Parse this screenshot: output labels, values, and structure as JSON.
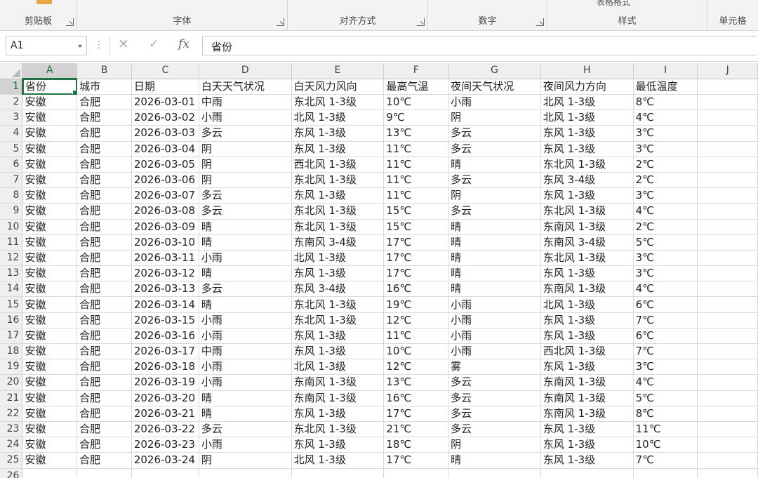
{
  "ribbon": {
    "groups": [
      {
        "label": "剪贴板"
      },
      {
        "label": "字体"
      },
      {
        "label": "对齐方式"
      },
      {
        "label": "数字"
      },
      {
        "label": "样式",
        "partial": "表格格式"
      },
      {
        "label": "单元格"
      }
    ]
  },
  "formula_bar": {
    "name_box": "A1",
    "formula": "省份"
  },
  "sheet": {
    "columns": [
      "A",
      "B",
      "C",
      "D",
      "E",
      "F",
      "G",
      "H",
      "I",
      "J"
    ],
    "rows": [
      [
        "省份",
        "城市",
        "日期",
        "白天天气状况",
        "白天风力风向",
        "最高气温",
        "夜间天气状况",
        "夜间风力方向",
        "最低温度"
      ],
      [
        "安徽",
        "合肥",
        "2026-03-01",
        "中雨",
        "东北风 1-3级",
        "10℃",
        "小雨",
        "北风 1-3级",
        "8℃"
      ],
      [
        "安徽",
        "合肥",
        "2026-03-02",
        "小雨",
        "北风 1-3级",
        "9℃",
        "阴",
        "北风 1-3级",
        "4℃"
      ],
      [
        "安徽",
        "合肥",
        "2026-03-03",
        "多云",
        "东风 1-3级",
        "13℃",
        "多云",
        "东风 1-3级",
        "3℃"
      ],
      [
        "安徽",
        "合肥",
        "2026-03-04",
        "阴",
        "东风 1-3级",
        "11℃",
        "多云",
        "东风 1-3级",
        "3℃"
      ],
      [
        "安徽",
        "合肥",
        "2026-03-05",
        "阴",
        "西北风 1-3级",
        "11℃",
        "晴",
        "东北风 1-3级",
        "2℃"
      ],
      [
        "安徽",
        "合肥",
        "2026-03-06",
        "阴",
        "东北风 1-3级",
        "11℃",
        "多云",
        "东风 3-4级",
        "2℃"
      ],
      [
        "安徽",
        "合肥",
        "2026-03-07",
        "多云",
        "东风 1-3级",
        "11℃",
        "阴",
        "东风 1-3级",
        "3℃"
      ],
      [
        "安徽",
        "合肥",
        "2026-03-08",
        "多云",
        "东北风 1-3级",
        "15℃",
        "多云",
        "东北风 1-3级",
        "4℃"
      ],
      [
        "安徽",
        "合肥",
        "2026-03-09",
        "晴",
        "东北风 1-3级",
        "15℃",
        "晴",
        "东南风 1-3级",
        "2℃"
      ],
      [
        "安徽",
        "合肥",
        "2026-03-10",
        "晴",
        "东南风 3-4级",
        "17℃",
        "晴",
        "东南风 3-4级",
        "5℃"
      ],
      [
        "安徽",
        "合肥",
        "2026-03-11",
        "小雨",
        "北风 1-3级",
        "17℃",
        "晴",
        "东北风 1-3级",
        "3℃"
      ],
      [
        "安徽",
        "合肥",
        "2026-03-12",
        "晴",
        "东风 1-3级",
        "17℃",
        "晴",
        "东风 1-3级",
        "3℃"
      ],
      [
        "安徽",
        "合肥",
        "2026-03-13",
        "多云",
        "东风 3-4级",
        "16℃",
        "晴",
        "东南风 1-3级",
        "4℃"
      ],
      [
        "安徽",
        "合肥",
        "2026-03-14",
        "晴",
        "东北风 1-3级",
        "19℃",
        "小雨",
        "北风 1-3级",
        "6℃"
      ],
      [
        "安徽",
        "合肥",
        "2026-03-15",
        "小雨",
        "东北风 1-3级",
        "12℃",
        "小雨",
        "东风 1-3级",
        "7℃"
      ],
      [
        "安徽",
        "合肥",
        "2026-03-16",
        "小雨",
        "东风 1-3级",
        "11℃",
        "小雨",
        "东风 1-3级",
        "6℃"
      ],
      [
        "安徽",
        "合肥",
        "2026-03-17",
        "中雨",
        "东风 1-3级",
        "10℃",
        "小雨",
        "西北风 1-3级",
        "7℃"
      ],
      [
        "安徽",
        "合肥",
        "2026-03-18",
        "小雨",
        "北风 1-3级",
        "12℃",
        "雾",
        "东风 1-3级",
        "3℃"
      ],
      [
        "安徽",
        "合肥",
        "2026-03-19",
        "小雨",
        "东南风 1-3级",
        "13℃",
        "多云",
        "东南风 1-3级",
        "4℃"
      ],
      [
        "安徽",
        "合肥",
        "2026-03-20",
        "晴",
        "东南风 1-3级",
        "16℃",
        "多云",
        "东南风 1-3级",
        "5℃"
      ],
      [
        "安徽",
        "合肥",
        "2026-03-21",
        "晴",
        "东风 1-3级",
        "17℃",
        "多云",
        "东南风 1-3级",
        "8℃"
      ],
      [
        "安徽",
        "合肥",
        "2026-03-22",
        "多云",
        "东北风 1-3级",
        "21℃",
        "多云",
        "东风 1-3级",
        "11℃"
      ],
      [
        "安徽",
        "合肥",
        "2026-03-23",
        "小雨",
        "东风 1-3级",
        "18℃",
        "阴",
        "东风 1-3级",
        "10℃"
      ],
      [
        "安徽",
        "合肥",
        "2026-03-24",
        "阴",
        "北风 1-3级",
        "17℃",
        "晴",
        "东风 1-3级",
        "7℃"
      ],
      [
        "",
        "",
        "",
        "",
        "",
        "",
        "",
        "",
        ""
      ]
    ]
  }
}
